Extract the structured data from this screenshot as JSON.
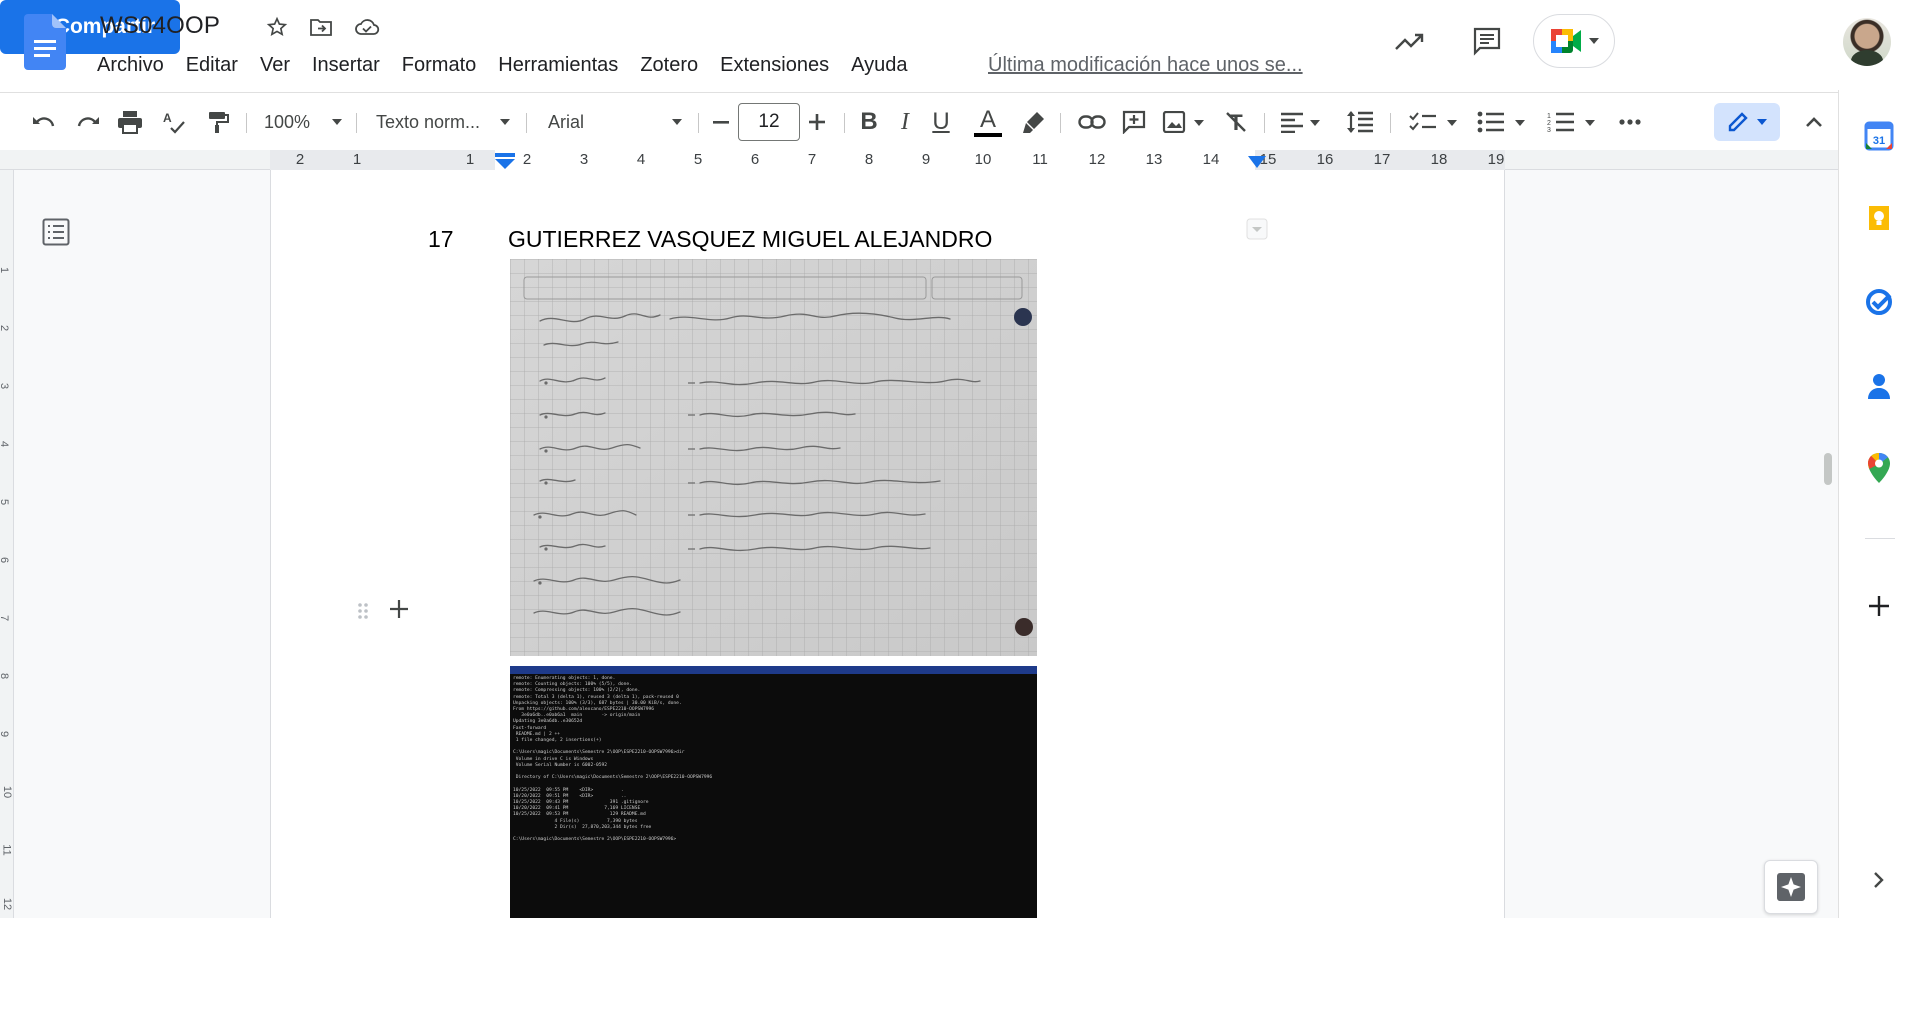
{
  "document": {
    "title": "WS04OOP",
    "last_edit": "Última modificación hace unos se..."
  },
  "menu": [
    "Archivo",
    "Editar",
    "Ver",
    "Insertar",
    "Formato",
    "Herramientas",
    "Zotero",
    "Extensiones",
    "Ayuda"
  ],
  "header": {
    "share_label": "Compartir",
    "icons": [
      "star-icon",
      "move-to-folder-icon",
      "cloud-saved-icon",
      "activity-trend-icon",
      "comments-icon",
      "meet-icon",
      "avatar"
    ]
  },
  "toolbar": {
    "zoom": "100%",
    "style": "Texto norm...",
    "font": "Arial",
    "font_size": "12",
    "icons": [
      "undo-icon",
      "redo-icon",
      "print-icon",
      "spellcheck-icon",
      "paint-format-icon",
      "decrease-font-icon",
      "increase-font-icon",
      "bold-icon",
      "italic-icon",
      "underline-icon",
      "text-color-icon",
      "highlight-icon",
      "link-icon",
      "add-comment-icon",
      "insert-image-icon",
      "clear-format-icon",
      "align-icon",
      "line-spacing-icon",
      "checklist-icon",
      "bullet-list-icon",
      "numbered-list-icon",
      "more-icon",
      "editing-mode-icon",
      "collapse-menu-icon"
    ]
  },
  "ruler": {
    "marks": [
      "2",
      "1",
      "1",
      "2",
      "3",
      "4",
      "5",
      "6",
      "7",
      "8",
      "9",
      "10",
      "11",
      "12",
      "13",
      "14",
      "15",
      "16",
      "17",
      "18",
      "19"
    ],
    "vertical_marks": [
      "1",
      "2",
      "3",
      "4",
      "5",
      "6",
      "7",
      "8",
      "9",
      "10",
      "11",
      "12"
    ]
  },
  "content": {
    "row_number": "17",
    "row_name": "GUTIERREZ VASQUEZ MIGUEL ALEJANDRO",
    "notebook_lines": [
      "Mobile quality ... portfolio ... website manager",
      "• Source code - Script to use with ...",
      "• ... script - Test of continuity",
      "• Application ... - Modular ... code",
      "• Cod ... - ... new ...",
      "• Deployed ... - ... to ... ",
      "• ... plan - ... requirements",
      "• Design documents",
      "Requirement ..."
    ],
    "terminal_lines": [
      "remote: Enumerating objects: 1, done.",
      "remote: Counting objects: 100% (5/5), done.",
      "remote: Compressing objects: 100% (2/2), done.",
      "remote: Total 3 (delta 1), reused 3 (delta 1), pack-reused 0",
      "Unpacking objects: 100% (3/3), 687 bytes | 30.00 KiB/s, done.",
      "From https://github.com/alexcano/ESPE2210-OOPSW7996",
      "   3e0a6db..e0ab6a1  main       -> origin/main",
      "Updating 3e0a6db..e30652d",
      "Fast-forward",
      " README.md | 2 ++",
      " 1 file changed, 2 insertions(+)",
      "",
      "C:\\Users\\magic\\Documents\\Semestre 2\\OOP\\ESPE2210-OOPSW7996>dir",
      " Volume in drive C is Windows",
      " Volume Serial Number is 6002-0592",
      "",
      " Directory of C:\\Users\\magic\\Documents\\Semestre 2\\OOP\\ESPE2210-OOPSW7996",
      "",
      "10/25/2022  09:55 PM    <DIR>          .",
      "10/20/2022  09:51 PM    <DIR>          ..",
      "10/25/2022  09:43 PM               391 .gitignore",
      "10/20/2022  09:41 PM             7,169 LICENSE",
      "10/25/2022  09:53 PM               129 README.md",
      "               4 File(s)          7,390 bytes",
      "               2 Dir(s)  27,870,203,344 bytes free",
      "",
      "C:\\Users\\magic\\Documents\\Semestre 2\\OOP\\ESPE2210-OOPSW7996>"
    ]
  },
  "side_panel": {
    "icons": [
      "calendar-icon",
      "keep-icon",
      "tasks-icon",
      "contacts-icon",
      "maps-icon",
      "add-addon-icon",
      "expand-panel-icon"
    ],
    "calendar_day": "31"
  }
}
